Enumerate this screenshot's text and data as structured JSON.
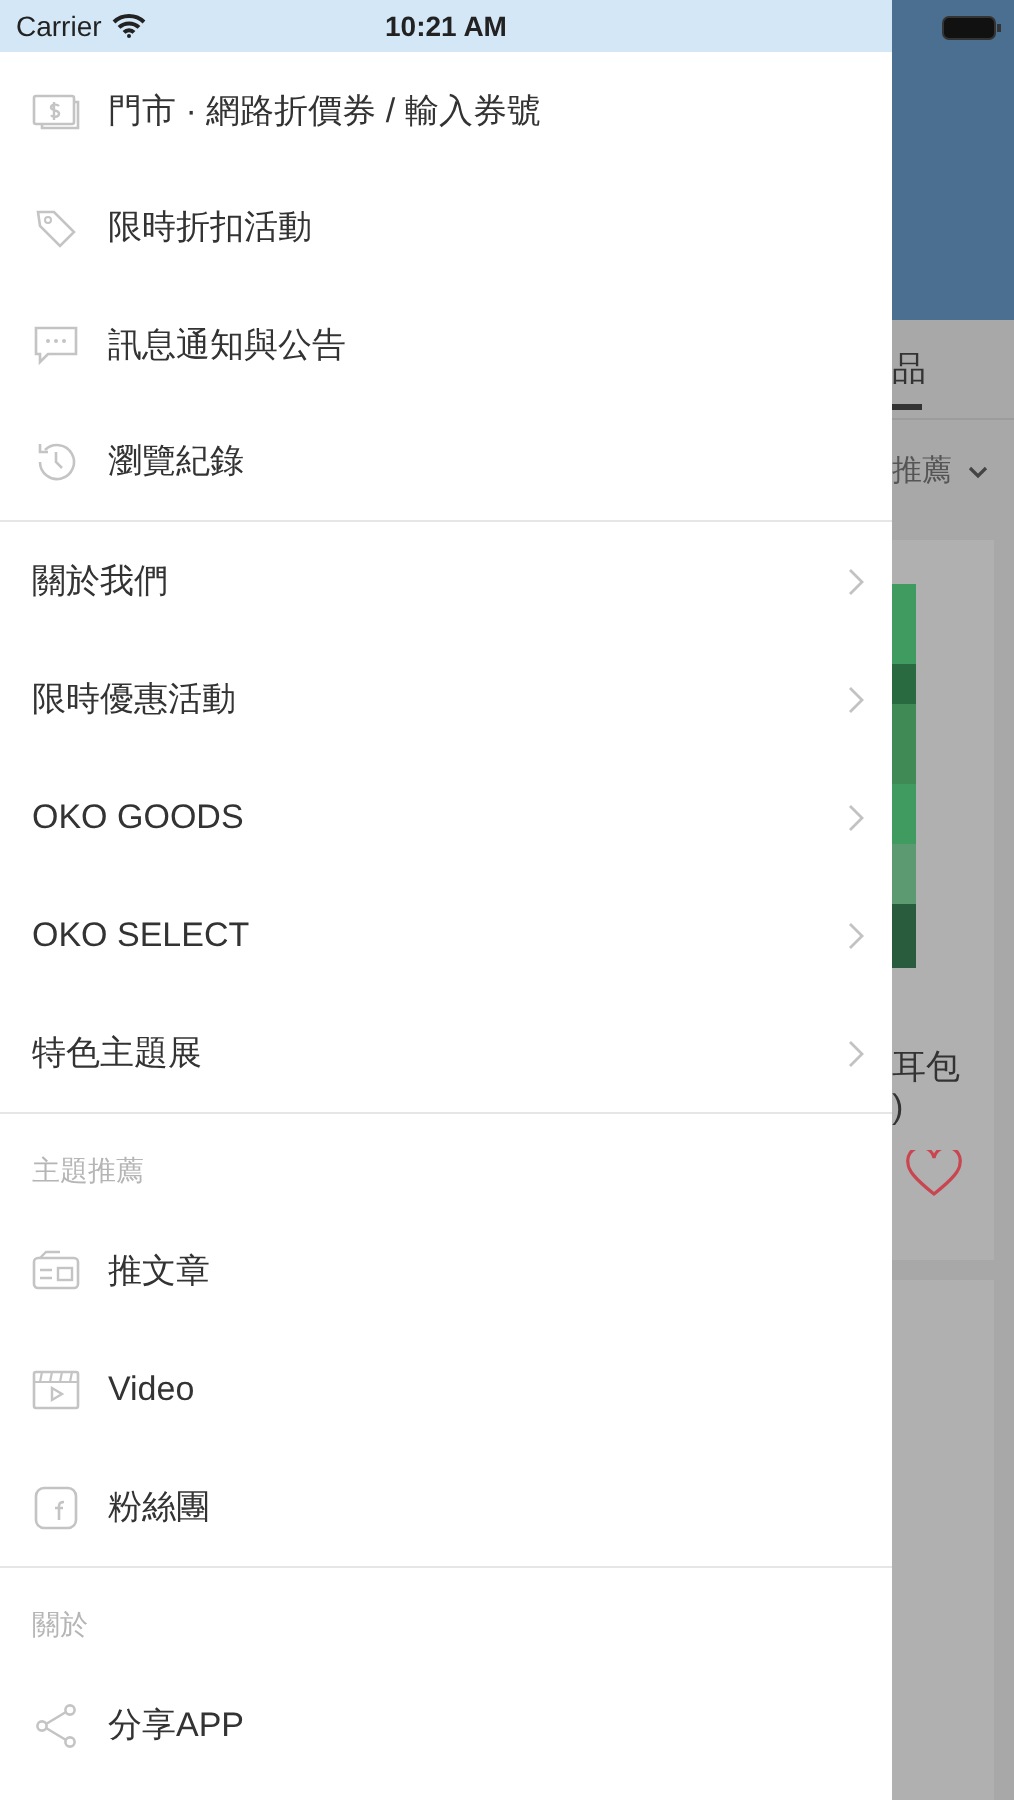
{
  "status_bar": {
    "carrier": "Carrier",
    "time": "10:21 AM"
  },
  "drawer": {
    "sections": [
      {
        "items": [
          {
            "kind": "link",
            "label": "門市 · 網路折價券 / 輸入券號"
          },
          {
            "kind": "link",
            "label": "限時折扣活動"
          },
          {
            "kind": "link",
            "label": "訊息通知與公告"
          },
          {
            "kind": "link",
            "label": "瀏覽紀錄"
          }
        ]
      },
      {
        "items": [
          {
            "kind": "submenu",
            "label": "關於我們"
          },
          {
            "kind": "submenu",
            "label": "限時優惠活動"
          },
          {
            "kind": "submenu",
            "label": "OKO GOODS"
          },
          {
            "kind": "submenu",
            "label": "OKO SELECT"
          },
          {
            "kind": "submenu",
            "label": "特色主題展"
          }
        ]
      },
      {
        "header": "主題推薦",
        "items": [
          {
            "kind": "link",
            "label": "推文章"
          },
          {
            "kind": "link",
            "label": "Video"
          },
          {
            "kind": "link",
            "label": "粉絲團"
          }
        ]
      },
      {
        "header": "關於",
        "items": [
          {
            "kind": "link",
            "label": "分享APP"
          }
        ]
      }
    ]
  },
  "background": {
    "tab": "品",
    "sort": "推薦",
    "product_title": [
      "耳包",
      ")"
    ]
  }
}
